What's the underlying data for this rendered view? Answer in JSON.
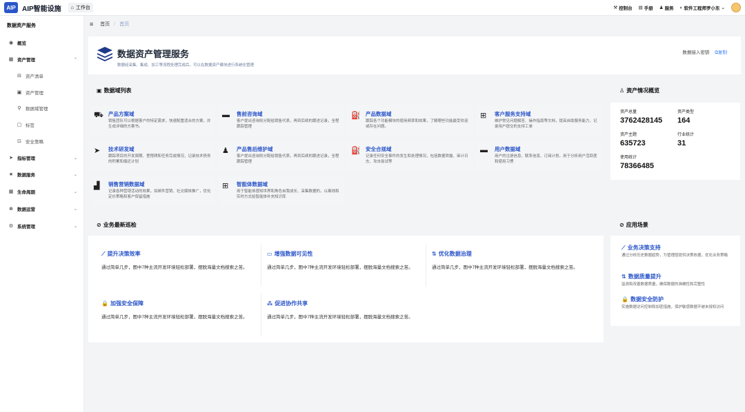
{
  "topbar": {
    "logo": "AIP",
    "app_title": "AIP智能设施",
    "work_tab": "工作台",
    "console": "控制台",
    "manual": "手册",
    "service": "服务",
    "user": "软件工程师罗小东"
  },
  "sidebar": {
    "title": "数据资产服务",
    "items": [
      {
        "label": "概览",
        "icon": "eye-icon",
        "level": "top"
      },
      {
        "label": "资产管理",
        "icon": "asset-icon",
        "level": "top",
        "expanded": true
      },
      {
        "label": "资产清单",
        "icon": "cart-icon",
        "level": "sub"
      },
      {
        "label": "资产管理",
        "icon": "box-icon",
        "level": "sub"
      },
      {
        "label": "数据域管理",
        "icon": "domain-icon",
        "level": "sub"
      },
      {
        "label": "标签",
        "icon": "tag-icon",
        "level": "sub"
      },
      {
        "label": "安全策略",
        "icon": "shield-icon",
        "level": "sub"
      },
      {
        "label": "指标管理",
        "icon": "send-icon",
        "level": "top"
      },
      {
        "label": "数据服务",
        "icon": "star-icon",
        "level": "top"
      },
      {
        "label": "生命周期",
        "icon": "grid-icon",
        "level": "top"
      },
      {
        "label": "数据运营",
        "icon": "ops-icon",
        "level": "top"
      },
      {
        "label": "系统管理",
        "icon": "gear-icon",
        "level": "top"
      }
    ]
  },
  "breadcrumb": {
    "home": "首页",
    "sep": "/",
    "current": "首页"
  },
  "header": {
    "title": "数据资产管理服务",
    "subtitle": "数据经采集、集成、加工等流程处理完成后，可以在数据资产模块进行系统化管理",
    "key_label": "数据接入密钥",
    "copy_label": "复制"
  },
  "domains": {
    "title": "数据域列表",
    "items": [
      {
        "name": "产品方案域",
        "desc": "销售团队可以根据客户的特定需求，快速配置适合的方案，并生成详细的方案书。",
        "icon": "truck-icon"
      },
      {
        "name": "售前咨询域",
        "desc": "客户提出咨询则分配给销售代表，再到后续的跟进记录，全程跟踪管理",
        "icon": "card-icon"
      },
      {
        "name": "产品数据域",
        "desc": "跟踪各个功能模块的使用频率和效果，了解哪些功能最受欢迎或存在问题。",
        "icon": "gas-icon"
      },
      {
        "name": "客户服务支持域",
        "desc": "维护常见问题解答、操作指南等文档，提高自助服务能力，记录用户提交的支持工单",
        "icon": "bus-icon"
      },
      {
        "name": "技术研发域",
        "desc": "跟踪项目的开发周期、里程碑和任务完成情况，记录技术债务的积累和偿还计划",
        "icon": "send-icon"
      },
      {
        "name": "产品售后维护域",
        "desc": "客户提出咨询则分配给销售代表，再到后续的跟进记录，全程跟踪管理",
        "icon": "user-icon"
      },
      {
        "name": "安全合规域",
        "desc": "记录任何安全事件的发生和处理情况，包括数据泄露、审计日志、攻击尝试等",
        "icon": "gas-icon"
      },
      {
        "name": "用户数据域",
        "desc": "用户的注册信息、联系信息、订阅计划。用于分析用户活跃度和使用习惯",
        "icon": "card-icon"
      },
      {
        "name": "销售营销数据域",
        "desc": "记录各种营销活动的效果，如邮件营销、社交媒体推广，优化定价策略和客户保留措施",
        "icon": "chart-icon"
      },
      {
        "name": "智能体数据域",
        "desc": "用于智能体感知世界和角色自我成长、采集数据的，以离线和实时方式给智能体补充知识库",
        "icon": "bus-icon"
      }
    ]
  },
  "overview": {
    "title": "资产情况概览",
    "stats": [
      {
        "label": "资产总量",
        "value": "3762428145"
      },
      {
        "label": "资产类型",
        "value": "164"
      },
      {
        "label": "资产主题",
        "value": "635723"
      },
      {
        "label": "行业统计",
        "value": "31"
      },
      {
        "label": "使用统计",
        "value": "78366485"
      }
    ]
  },
  "patrol": {
    "title": "业务最新巡检",
    "items": [
      {
        "title": "提升决策效率",
        "desc": "通过简单几步，图中7种主流开发环境轻松部署，摆脱海量文档搜索之苦。",
        "icon": "line-chart-icon"
      },
      {
        "title": "增强数据可见性",
        "desc": "通过简单几步，图中7种主流开发环境轻松部署，摆脱海量文档搜索之苦。",
        "icon": "dashboard-icon"
      },
      {
        "title": "优化数据治理",
        "desc": "通过简单几步，图中7种主流开发环境轻松部署，摆脱海量文档搜索之苦。",
        "icon": "sort-icon"
      },
      {
        "title": "加强安全保障",
        "desc": "通过简单几步，图中7种主流开发环境轻松部署，摆脱海量文档搜索之苦。",
        "icon": "lock-icon"
      },
      {
        "title": "促进协作共享",
        "desc": "通过简单几步，图中7种主流开发环境轻松部署，摆脱海量文档搜索之苦。",
        "icon": "network-icon"
      }
    ]
  },
  "scenes": {
    "title": "应用场景",
    "items": [
      {
        "title": "业务决策支持",
        "desc": "通过分析历史数据趋势，为管理层提供决策依据，优化业务策略",
        "icon": "line-chart-icon"
      },
      {
        "title": "数据质量提升",
        "desc": "监测和改善数据质量，确保数据的准确性和完整性",
        "icon": "sort-icon"
      },
      {
        "title": "数据安全防护",
        "desc": "实施数据访问控制和加密措施，保护敏感数据不被未授权访问",
        "icon": "lock-icon"
      }
    ]
  }
}
